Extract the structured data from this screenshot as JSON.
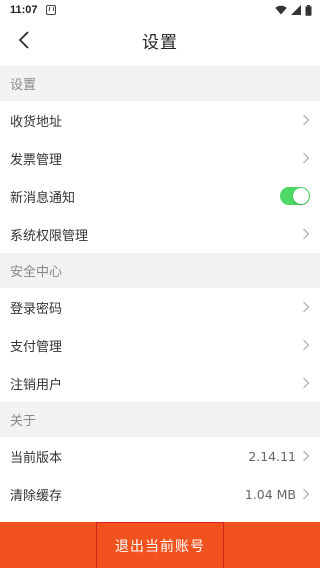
{
  "status_bar": {
    "time": "11:07"
  },
  "nav": {
    "title": "设置"
  },
  "sections": {
    "settings": {
      "label": "设置"
    },
    "security": {
      "label": "安全中心"
    },
    "about": {
      "label": "关于"
    }
  },
  "rows": {
    "shipping_address": {
      "label": "收货地址"
    },
    "invoice_management": {
      "label": "发票管理"
    },
    "new_message_notification": {
      "label": "新消息通知",
      "toggle_on": true
    },
    "system_permissions": {
      "label": "系统权限管理"
    },
    "login_password": {
      "label": "登录密码"
    },
    "payment_management": {
      "label": "支付管理"
    },
    "deregister_user": {
      "label": "注销用户"
    },
    "current_version": {
      "label": "当前版本",
      "value": "2.14.11"
    },
    "clear_cache": {
      "label": "清除缓存",
      "value": "1.04 MB"
    }
  },
  "logout": {
    "label": "退出当前账号"
  },
  "colors": {
    "accent": "#f2521e",
    "toggle_on": "#4cd964",
    "section_bg": "#f2f2f2",
    "logout_border": "#d62020"
  }
}
